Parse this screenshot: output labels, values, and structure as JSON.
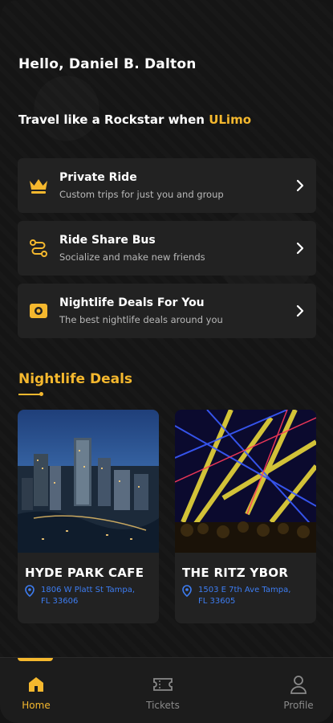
{
  "header": {
    "greeting": "Hello, Daniel B. Dalton",
    "tagline_prefix": "Travel like a Rockstar when ",
    "brand": "ULimo"
  },
  "menu": [
    {
      "title": "Private Ride",
      "subtitle": "Custom trips for just you and group",
      "icon": "crown-icon"
    },
    {
      "title": "Ride Share Bus",
      "subtitle": "Socialize and make new friends",
      "icon": "route-icon"
    },
    {
      "title": "Nightlife Deals For You",
      "subtitle": "The best nightlife deals around you",
      "icon": "ticket-icon"
    }
  ],
  "deals_section": {
    "title": "Nightlife Deals",
    "items": [
      {
        "name": "HYDE PARK CAFE",
        "address": "1806 W Platt St Tampa, FL 33606",
        "image": "city-skyline-image"
      },
      {
        "name": "THE RITZ YBOR",
        "address": "1503 E 7th Ave Tampa, FL 33605",
        "image": "concert-lights-image"
      }
    ]
  },
  "bottom_nav": [
    {
      "label": "Home",
      "icon": "home-icon",
      "active": true
    },
    {
      "label": "Tickets",
      "icon": "ticket-icon",
      "active": false
    },
    {
      "label": "Profile",
      "icon": "profile-icon",
      "active": false
    }
  ],
  "colors": {
    "accent": "#f5b82e",
    "address": "#3d7df2",
    "card": "#222222",
    "background": "#151515"
  }
}
